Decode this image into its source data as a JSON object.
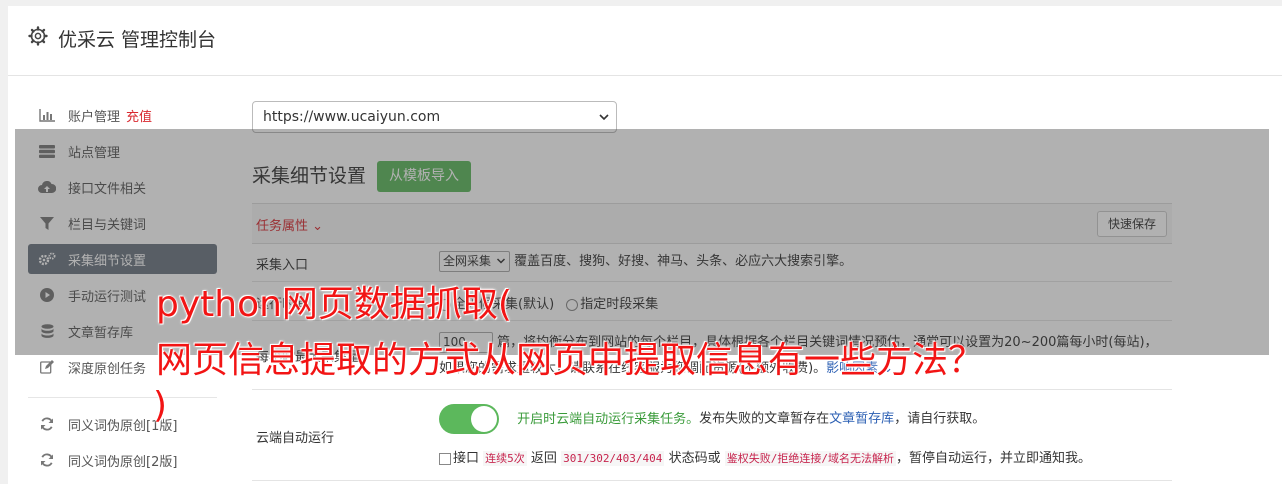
{
  "header": {
    "title": "优采云 管理控制台",
    "icon": "gear-icon"
  },
  "sidebar": {
    "items": [
      {
        "label": "账户管理",
        "badge": "充值",
        "icon": "bar-chart-icon"
      },
      {
        "label": "站点管理",
        "icon": "server-icon"
      },
      {
        "label": "接口文件相关",
        "icon": "cloud-upload-icon"
      },
      {
        "label": "栏目与关键词",
        "icon": "filter-icon"
      },
      {
        "label": "采集细节设置",
        "icon": "gears-icon",
        "active": true
      },
      {
        "label": "手动运行测试",
        "icon": "play-circle-icon"
      },
      {
        "label": "文章暂存库",
        "icon": "database-icon"
      },
      {
        "label": "深度原创任务",
        "icon": "edit-icon"
      },
      {
        "label": "同义词伪原创[1版]",
        "icon": "refresh-icon"
      },
      {
        "label": "同义词伪原创[2版]",
        "icon": "refresh-icon"
      }
    ]
  },
  "main": {
    "site_select": {
      "value": "https://www.ucaiyun.com"
    },
    "section_title": "采集细节设置",
    "import_button": "从模板导入",
    "task_header": {
      "label": "任务属性 ⌄",
      "save_button": "快速保存"
    },
    "rows": {
      "entry": {
        "label": "采集入口",
        "select_value": "全网采集",
        "desc": "覆盖百度、搜狗、好搜、神马、头条、必应六大搜索引擎。"
      },
      "time": {
        "label": "运行时间",
        "opt1": "全天候采集(默认)",
        "opt2": "指定时段采集"
      },
      "quantity": {
        "label": "每小时最大采集量",
        "number": "100",
        "line1_a": "篇，将均衡分布到网站的每个栏目，具体根据各个栏目关键词情况预估，通常可以设置为20~200篇每小时(每站)，",
        "line2_a": "如果您的需求量较大，请联系在线客服为您调配资源(不额外收费)。",
        "line2_link": "影响因素 ⌄"
      },
      "cloud": {
        "label": "云端自动运行",
        "toggle_text": "开启时云端自动运行采集任务。",
        "toggle_rest_a": "发布失败的文章暂存在",
        "toggle_link": "文章暂存库",
        "toggle_rest_b": "，请自行获取。",
        "chk_a": "接口",
        "code1": "连续5次",
        "chk_b": "返回",
        "code2": "301/302/403/404",
        "chk_c": "状态码或",
        "code3": "鉴权失败/拒绝连接/域名无法解析",
        "chk_d": "，暂停自动运行，并立即通知我。"
      }
    }
  },
  "watermark": {
    "line1": "python网页数据抓取(",
    "line2": "网页信息提取的方式从网页中提取信息有一些方法？",
    "line3": ")"
  },
  "colors": {
    "accent_green": "#5cb85c",
    "alert_red": "#d9282f",
    "active_bg": "#6c7580",
    "link_blue": "#2b5fb3"
  }
}
